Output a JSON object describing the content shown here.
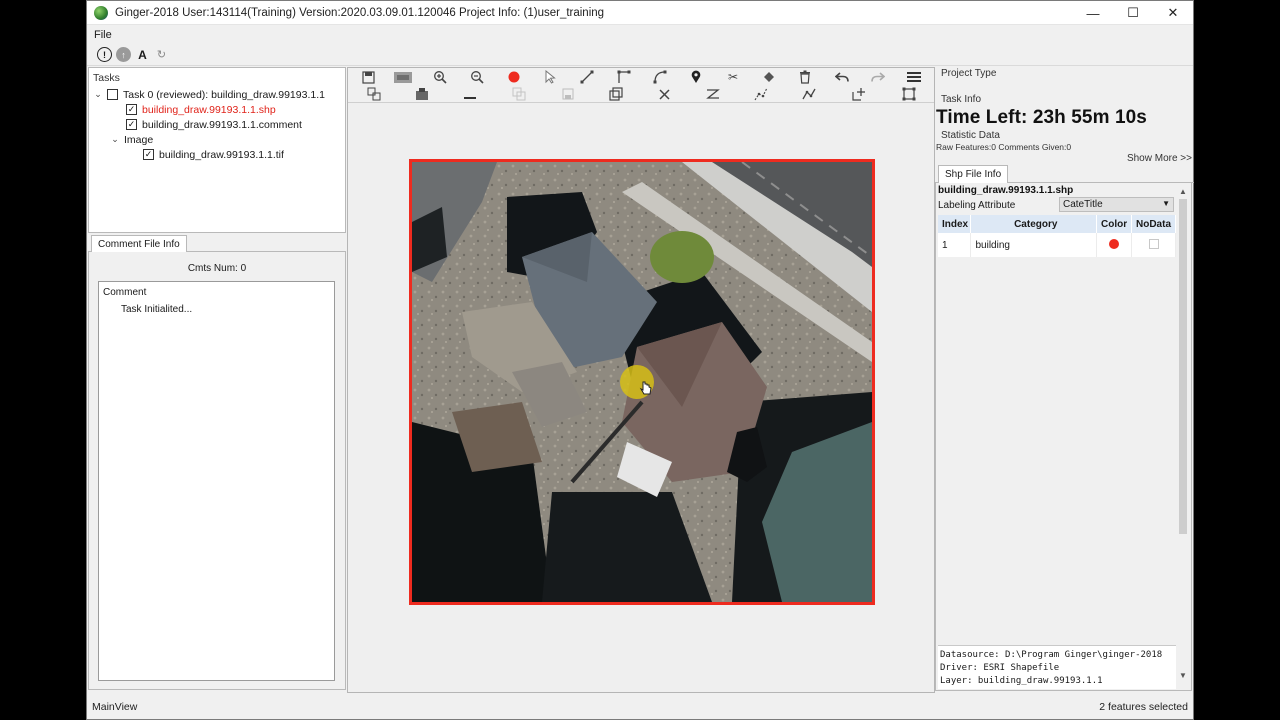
{
  "window": {
    "title": "Ginger-2018   User:143114(Training)   Version:2020.03.09.01.120046   Project Info: (1)user_training",
    "minimize": "—",
    "maximize": "☐",
    "close": "✕"
  },
  "menu": {
    "file": "File"
  },
  "mini_toolbar": {
    "text_tool": "A"
  },
  "tasks": {
    "label": "Tasks",
    "task0": "Task 0 (reviewed): building_draw.99193.1.1",
    "shp_file": "building_draw.99193.1.1.shp",
    "comment_file": "building_draw.99193.1.1.comment",
    "image_group": "Image",
    "tif_file": "building_draw.99193.1.1.tif"
  },
  "comment_panel": {
    "tab": "Comment File Info",
    "cmts_num": "Cmts Num: 0",
    "header": "Comment",
    "entry": "Task Initialited..."
  },
  "right_panel": {
    "project_type": "Project Type",
    "task_info": "Task Info",
    "time_left": "Time Left: 23h 55m 10s",
    "statistic": "Statistic Data",
    "raw_features": "Raw Features:0 Comments Given:0",
    "show_more": "Show More >>",
    "shp_tab": "Shp File Info",
    "shp_file": "building_draw.99193.1.1.shp",
    "labeling_attribute": "Labeling Attribute",
    "labeling_value": "CateTitle",
    "table": {
      "headers": [
        "Index",
        "Category",
        "Color",
        "NoData"
      ],
      "rows": [
        {
          "index": "1",
          "category": "building",
          "color": "#ee2b1f"
        }
      ]
    },
    "info": {
      "datasource": "Datasource: D:\\Program Ginger\\ginger-2018",
      "driver": "Driver: ESRI Shapefile",
      "layer": "Layer: building_draw.99193.1.1"
    }
  },
  "status": {
    "left": "MainView",
    "right": "2 features selected"
  },
  "colors": {
    "accent_red": "#ee2b1f",
    "highlight_yellow": "#d6be16",
    "table_header": "#dde8f5"
  }
}
